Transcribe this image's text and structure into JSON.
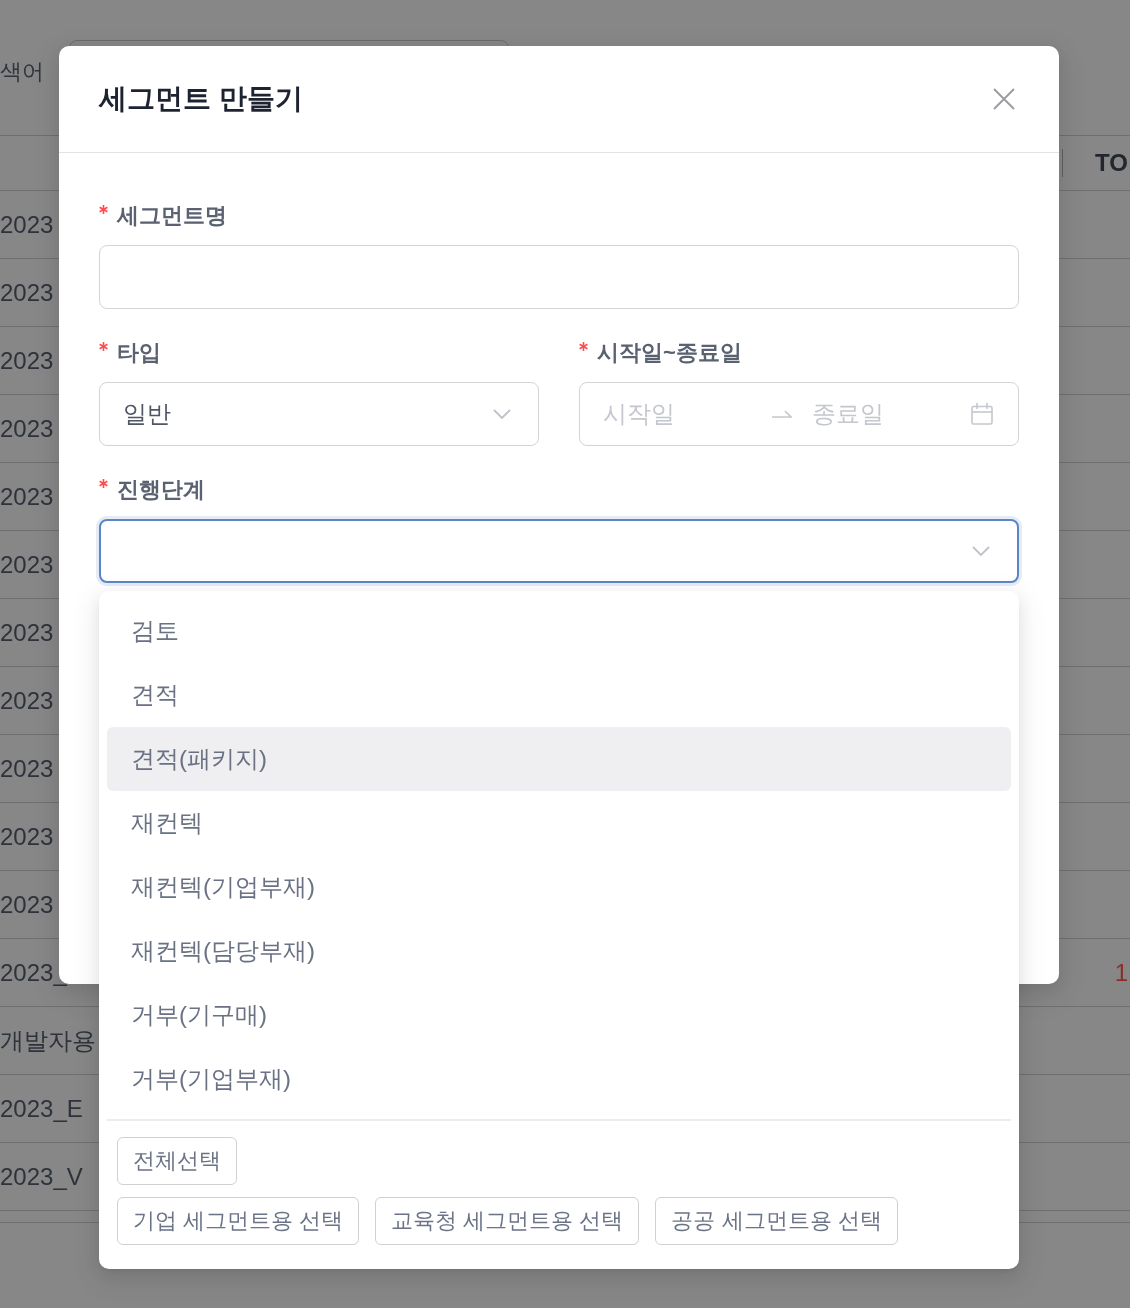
{
  "background_page": {
    "search_label": "색어",
    "table": {
      "last_column_label": "TO",
      "rows": [
        {
          "first_cell": "2023"
        },
        {
          "first_cell": "2023"
        },
        {
          "first_cell": "2023"
        },
        {
          "first_cell": "2023"
        },
        {
          "first_cell": "2023"
        },
        {
          "first_cell": "2023"
        },
        {
          "first_cell": "2023"
        },
        {
          "first_cell": "2023"
        },
        {
          "first_cell": "2023"
        },
        {
          "first_cell": "2023"
        },
        {
          "first_cell": "2023"
        },
        {
          "first_cell": "2023_",
          "last_cell": "1"
        },
        {
          "first_cell": "개발자용"
        },
        {
          "first_cell": "2023_E"
        },
        {
          "first_cell": "2023_V"
        }
      ]
    }
  },
  "modal": {
    "title": "세그먼트 만들기",
    "form_rows": [
      [
        {
          "kind": "text",
          "label": "세그먼트명",
          "required": true
        }
      ],
      [
        {
          "kind": "select",
          "label": "타입",
          "required": true,
          "value": "일반",
          "focused": false
        },
        {
          "kind": "date_range",
          "label": "시작일~종료일",
          "required": true,
          "start": {
            "placeholder": "시작일"
          },
          "end": {
            "placeholder": "종료일"
          }
        }
      ],
      [
        {
          "kind": "select",
          "label": "진행단계",
          "required": true,
          "focused": true,
          "options": [
            {
              "label": "검토",
              "selected": false,
              "highlighted": false
            },
            {
              "label": "견적",
              "selected": false,
              "highlighted": false
            },
            {
              "label": "견적(패키지)",
              "selected": false,
              "highlighted": true
            },
            {
              "label": "재컨텍",
              "selected": false,
              "highlighted": false
            },
            {
              "label": "재컨텍(기업부재)",
              "selected": false,
              "highlighted": false
            },
            {
              "label": "재컨텍(담당부재)",
              "selected": false,
              "highlighted": false
            },
            {
              "label": "거부(기구매)",
              "selected": false,
              "highlighted": false
            },
            {
              "label": "거부(기업부재)",
              "selected": false,
              "highlighted": false
            }
          ],
          "button_rows": [
            [
              "전체선택"
            ],
            [
              "기업 세그먼트용 선택",
              "교육청 세그먼트용 선택",
              "공공 세그먼트용 선택"
            ]
          ]
        }
      ]
    ]
  }
}
